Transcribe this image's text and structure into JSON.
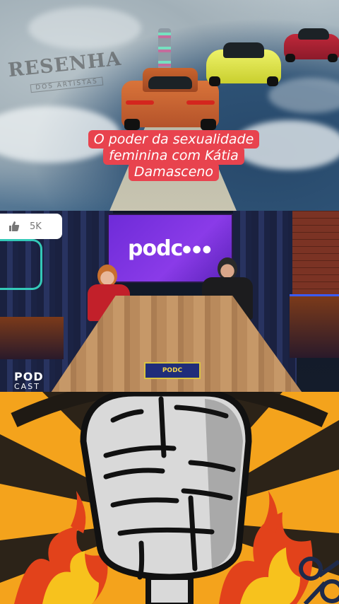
{
  "video": {
    "watermark": {
      "main": "RESENHA",
      "sub": "DOS ARTISTAS"
    },
    "caption_lines": [
      "O poder da sexualidade",
      "feminina com Kátia",
      "Damasceno"
    ],
    "like_count": "5K",
    "screen_logo": "podc",
    "podcast_logo": {
      "line1": "POD",
      "line2": "CAST"
    },
    "table_sign": "PODC",
    "icons": [
      "thumbs-up-icon",
      "microphone-icon",
      "scissors-icon"
    ],
    "colors": {
      "caption_bg": "#e8434e",
      "screen": "#7c32e0",
      "mic_bg": "#f4a31c",
      "flame": "#e2421b"
    }
  }
}
